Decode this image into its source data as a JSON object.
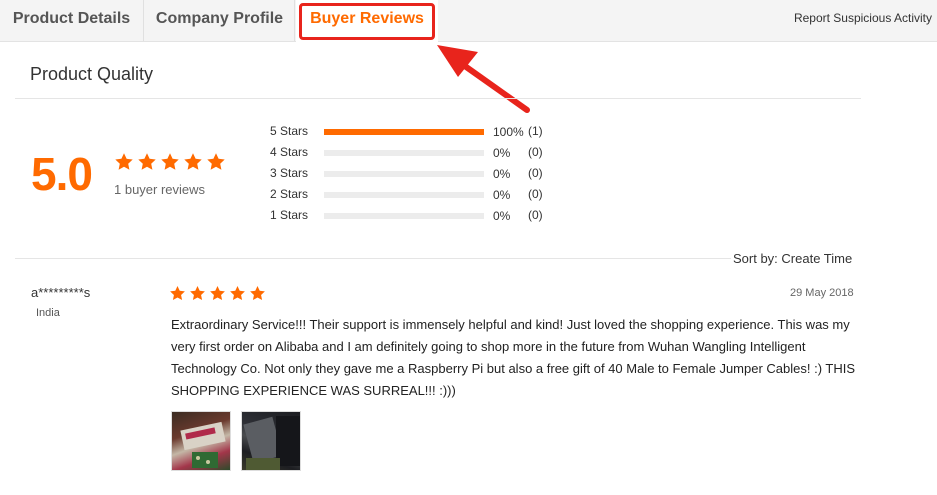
{
  "tabs": [
    {
      "label": "Product Details",
      "active": false
    },
    {
      "label": "Company Profile",
      "active": false
    },
    {
      "label": "Buyer Reviews",
      "active": true
    }
  ],
  "header": {
    "report_link": "Report Suspicious Activity"
  },
  "colors": {
    "accent": "#ff6a00",
    "annotation": "#e8241c",
    "bar_track": "#ececec"
  },
  "section": {
    "title": "Product Quality"
  },
  "summary": {
    "score": "5.0",
    "stars": 5,
    "review_count_text": "1 buyer reviews"
  },
  "distribution": [
    {
      "label": "5 Stars",
      "fraction": 1.0,
      "percent_text": "100%",
      "count_text": "(1)"
    },
    {
      "label": "4 Stars",
      "fraction": 0.0,
      "percent_text": "0%",
      "count_text": "(0)"
    },
    {
      "label": "3 Stars",
      "fraction": 0.0,
      "percent_text": "0%",
      "count_text": "(0)"
    },
    {
      "label": "2 Stars",
      "fraction": 0.0,
      "percent_text": "0%",
      "count_text": "(0)"
    },
    {
      "label": "1 Stars",
      "fraction": 0.0,
      "percent_text": "0%",
      "count_text": "(0)"
    }
  ],
  "sort": {
    "label": "Sort by: Create Time"
  },
  "review": {
    "reviewer": "a*********s",
    "country": "India",
    "stars": 5,
    "date": "29 May 2018",
    "text": "Extraordinary Service!!! Their support is immensely helpful and kind! Just loved the shopping experience. This was my very first order on Alibaba and I am definitely going to shop more in the future from Wuhan Wangling Intelligent Technology Co. Not only they gave me a Raspberry Pi but also a free gift of 40 Male to Female Jumper Cables! :) THIS SHOPPING EXPERIENCE WAS SURREAL!!! :)))",
    "images": [
      "raspberry-pi-box-photo",
      "cables-photo"
    ]
  }
}
